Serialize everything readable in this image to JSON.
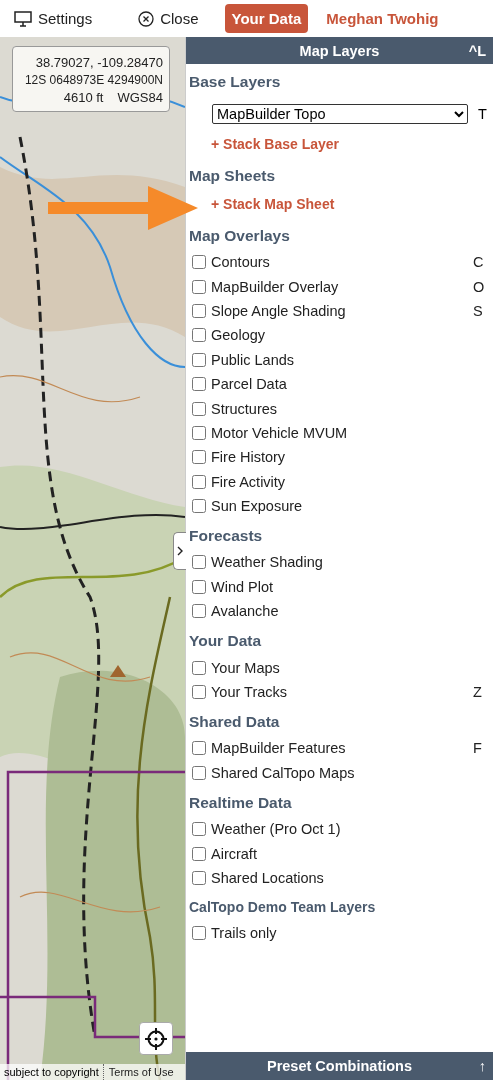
{
  "toolbar": [
    {
      "kind": "settings",
      "label": "Settings"
    },
    {
      "kind": "close",
      "label": "Close"
    },
    {
      "kind": "pill",
      "label": "Your Data"
    },
    {
      "kind": "link",
      "label": "Meghan Twohig"
    }
  ],
  "map": {
    "kind": "picture",
    "coordinates": [
      "38.79027, -109.28470",
      "12S 0648973E 4294900N"
    ],
    "elevation": "4610 ft",
    "datum": "WGS84",
    "attribution": [
      "subject to copyright",
      "Terms of Use"
    ]
  },
  "panel": {
    "title": "Map Layers",
    "shortcut": "^L",
    "sections": [
      {
        "title": "Base Layers",
        "items": [
          {
            "kind": "select",
            "value": "MapBuilder Topo",
            "shortcut": "T"
          },
          {
            "kind": "link",
            "label": "+ Stack Base Layer"
          }
        ]
      },
      {
        "title": "Map Sheets",
        "items": [
          {
            "kind": "link",
            "label": "+ Stack Map Sheet"
          }
        ]
      },
      {
        "title": "Map Overlays",
        "items": [
          {
            "kind": "checkbox",
            "label": "Contours",
            "checked": false,
            "shortcut": "C"
          },
          {
            "kind": "checkbox",
            "label": "MapBuilder Overlay",
            "checked": false,
            "shortcut": "O"
          },
          {
            "kind": "checkbox",
            "label": "Slope Angle Shading",
            "checked": false,
            "shortcut": "S"
          },
          {
            "kind": "checkbox",
            "label": "Geology",
            "checked": false
          },
          {
            "kind": "checkbox",
            "label": "Public Lands",
            "checked": false
          },
          {
            "kind": "checkbox",
            "label": "Parcel Data",
            "checked": false
          },
          {
            "kind": "checkbox",
            "label": "Structures",
            "checked": false
          },
          {
            "kind": "checkbox",
            "label": "Motor Vehicle MVUM",
            "checked": false
          },
          {
            "kind": "checkbox",
            "label": "Fire History",
            "checked": false
          },
          {
            "kind": "checkbox",
            "label": "Fire Activity",
            "checked": false
          },
          {
            "kind": "checkbox",
            "label": "Sun Exposure",
            "checked": false
          }
        ]
      },
      {
        "title": "Forecasts",
        "items": [
          {
            "kind": "checkbox",
            "label": "Weather Shading",
            "checked": false
          },
          {
            "kind": "checkbox",
            "label": "Wind Plot",
            "checked": false
          },
          {
            "kind": "checkbox",
            "label": "Avalanche",
            "checked": false
          }
        ]
      },
      {
        "title": "Your Data",
        "items": [
          {
            "kind": "checkbox",
            "label": "Your Maps",
            "checked": false
          },
          {
            "kind": "checkbox",
            "label": "Your Tracks",
            "checked": false,
            "shortcut": "Z"
          }
        ]
      },
      {
        "title": "Shared Data",
        "items": [
          {
            "kind": "checkbox",
            "label": "MapBuilder Features",
            "checked": false,
            "shortcut": "F"
          },
          {
            "kind": "checkbox",
            "label": "Shared CalTopo Maps",
            "checked": false
          }
        ]
      },
      {
        "title": "Realtime Data",
        "items": [
          {
            "kind": "checkbox",
            "label": "Weather (Pro Oct 1)",
            "checked": false
          },
          {
            "kind": "checkbox",
            "label": "Aircraft",
            "checked": false
          },
          {
            "kind": "checkbox",
            "label": "Shared Locations",
            "checked": false
          }
        ]
      },
      {
        "title": "CalTopo Demo Team Layers",
        "small": true,
        "items": [
          {
            "kind": "checkbox",
            "label": "Trails only",
            "checked": false
          }
        ]
      }
    ]
  },
  "footer": {
    "title": "Preset Combinations",
    "arrow": "↑"
  }
}
